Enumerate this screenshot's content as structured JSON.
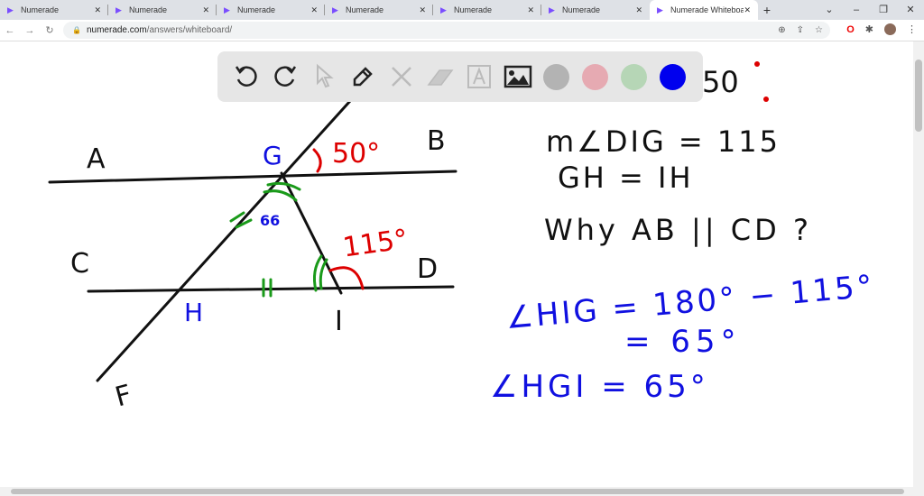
{
  "browser": {
    "tabs": [
      {
        "label": "Numerade"
      },
      {
        "label": "Numerade"
      },
      {
        "label": "Numerade"
      },
      {
        "label": "Numerade"
      },
      {
        "label": "Numerade"
      },
      {
        "label": "Numerade"
      },
      {
        "label": "Numerade Whiteboard"
      }
    ],
    "url_host": "numerade.com",
    "url_path": "/answers/whiteboard/"
  },
  "toolbar": {
    "tools": [
      "undo-icon",
      "redo-icon",
      "pointer-icon",
      "pen-icon",
      "tools-icon",
      "eraser-icon",
      "text-icon",
      "image-icon"
    ],
    "colors": [
      "#b3b3b3",
      "#e6aab2",
      "#b6d6b6",
      "#0000ee"
    ]
  },
  "figure": {
    "points": {
      "A": "A",
      "B": "B",
      "C": "C",
      "D": "D",
      "F": "F",
      "G": "G",
      "H": "H",
      "I": "I"
    },
    "angle_50": "50°",
    "angle_115": "115°",
    "angle_66": "66"
  },
  "notes": {
    "given1": "50",
    "given2": "m∠DIG = 115",
    "given3": "GH = IH",
    "question": "Why AB || CD ?",
    "work1": "∠HIG = 180° − 115°",
    "work2": "= 65°",
    "work3": "∠HGI = 65°"
  }
}
